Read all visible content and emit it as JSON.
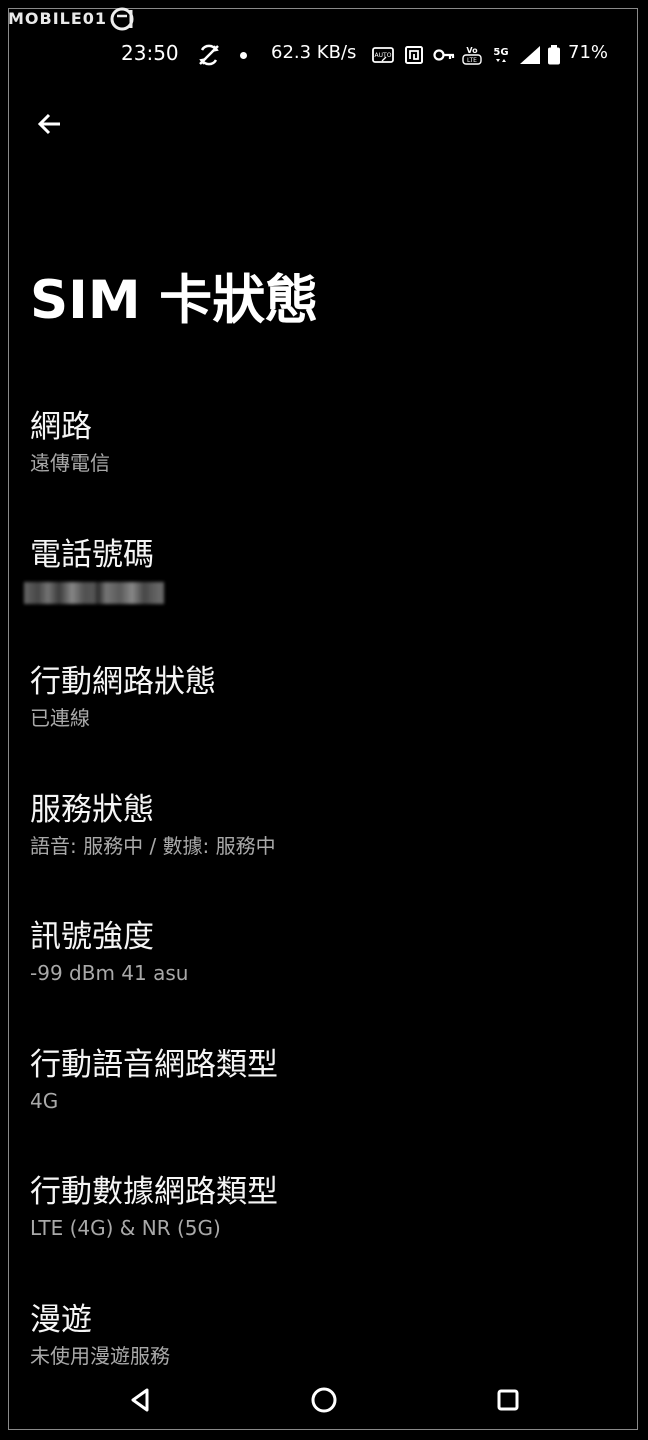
{
  "watermark": {
    "text": "MOBILE01"
  },
  "status_bar": {
    "time": "23:50",
    "speed": "62.3 KB/s",
    "network_type": "5G",
    "battery_percent": "71%",
    "icons": [
      "sync-off-icon",
      "dot-icon",
      "auto-icon",
      "nfc-icon",
      "vpn-key-icon",
      "volte-icon",
      "5g-icon",
      "signal-icon",
      "battery-icon"
    ]
  },
  "header": {
    "back_icon": "arrow-back-icon",
    "title": "SIM 卡狀態"
  },
  "items": [
    {
      "title": "網路",
      "summary": "遠傳電信"
    },
    {
      "title": "電話號碼",
      "summary": ""
    },
    {
      "title": "行動網路狀態",
      "summary": "已連線"
    },
    {
      "title": "服務狀態",
      "summary": "語音: 服務中 / 數據: 服務中"
    },
    {
      "title": "訊號強度",
      "summary": "-99 dBm 41 asu"
    },
    {
      "title": "行動語音網路類型",
      "summary": "4G"
    },
    {
      "title": "行動數據網路類型",
      "summary": "LTE (4G) & NR (5G)"
    },
    {
      "title": "漫遊",
      "summary": "未使用漫遊服務"
    }
  ],
  "nav_bar": {
    "icons": [
      "back-triangle-icon",
      "home-circle-icon",
      "recents-square-icon"
    ]
  }
}
